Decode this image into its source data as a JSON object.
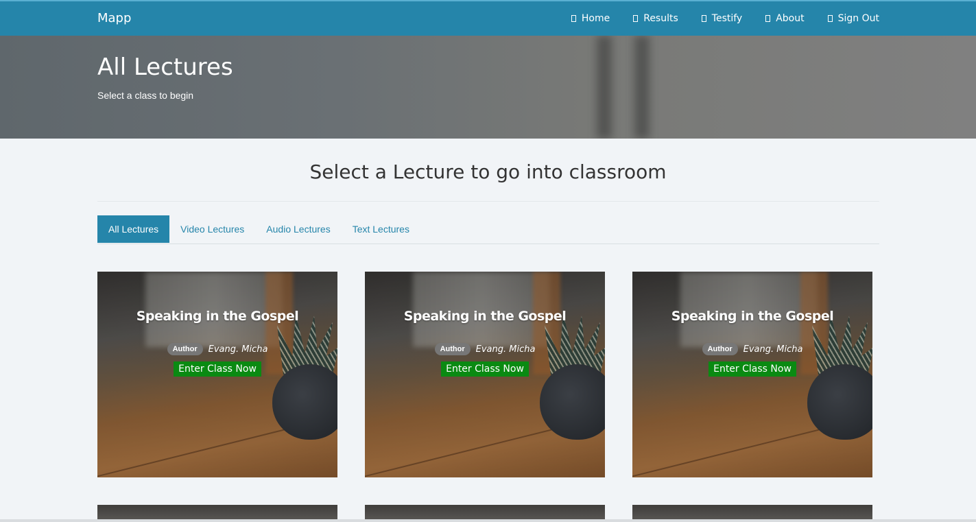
{
  "app": {
    "brand": "Mapp"
  },
  "nav": {
    "items": [
      {
        "label": "Home",
        "icon": "home-icon"
      },
      {
        "label": "Results",
        "icon": "results-icon"
      },
      {
        "label": "Testify",
        "icon": "testify-icon"
      },
      {
        "label": "About",
        "icon": "about-icon"
      },
      {
        "label": "Sign Out",
        "icon": "sign-out-icon"
      }
    ]
  },
  "hero": {
    "title": "All Lectures",
    "subtitle": "Select a class to begin"
  },
  "main": {
    "heading": "Select a Lecture to go into classroom",
    "tabs": [
      {
        "label": "All Lectures",
        "active": true
      },
      {
        "label": "Video Lectures",
        "active": false
      },
      {
        "label": "Audio Lectures",
        "active": false
      },
      {
        "label": "Text Lectures",
        "active": false
      }
    ],
    "cards": [
      {
        "title": "Speaking in the Gospel",
        "badge": "Author",
        "author": "Evang. Micha",
        "button": "Enter Class Now"
      },
      {
        "title": "Speaking in the Gospel",
        "badge": "Author",
        "author": "Evang. Micha",
        "button": "Enter Class Now"
      },
      {
        "title": "Speaking in the Gospel",
        "badge": "Author",
        "author": "Evang. Micha",
        "button": "Enter Class Now"
      }
    ]
  },
  "colors": {
    "primary": "#2585aa",
    "button_green": "#0a8a12",
    "background": "#f1f4f7"
  }
}
